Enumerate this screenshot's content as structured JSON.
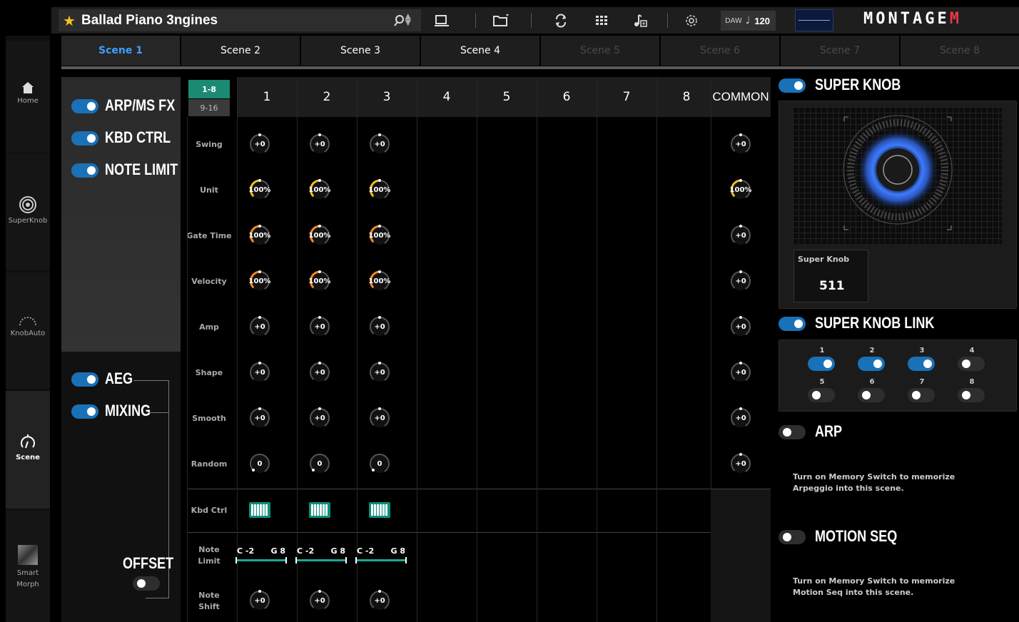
{
  "header": {
    "preset_name": "Ballad Piano 3ngines",
    "daw_label": "DAW",
    "tempo": "120",
    "logo": "MONTAGE",
    "logo_suffix": "M"
  },
  "tabs": [
    {
      "label": "Scene 1",
      "state": "active"
    },
    {
      "label": "Scene 2",
      "state": "normal"
    },
    {
      "label": "Scene 3",
      "state": "normal"
    },
    {
      "label": "Scene 4",
      "state": "normal"
    },
    {
      "label": "Scene 5",
      "state": "disabled"
    },
    {
      "label": "Scene 6",
      "state": "disabled"
    },
    {
      "label": "Scene 7",
      "state": "disabled"
    },
    {
      "label": "Scene 8",
      "state": "disabled"
    }
  ],
  "nav": [
    {
      "label": "Home",
      "icon": "home-icon"
    },
    {
      "label": "SuperKnob",
      "icon": "superknob-icon"
    },
    {
      "label": "KnobAuto",
      "icon": "knobauto-icon"
    },
    {
      "label": "Scene",
      "icon": "scene-icon"
    },
    {
      "label": "Smart\nMorph",
      "icon": "smartmorph-icon"
    }
  ],
  "switches": {
    "arp_ms_fx": "ARP/MS FX",
    "kbd_ctrl": "KBD CTRL",
    "note_limit": "NOTE LIMIT",
    "aeg": "AEG",
    "mixing": "MIXING",
    "offset": "OFFSET"
  },
  "grid": {
    "range_active": "1-8",
    "range_other": "9-16",
    "columns": [
      "1",
      "2",
      "3",
      "4",
      "5",
      "6",
      "7",
      "8"
    ],
    "common": "COMMON",
    "rows": {
      "swing": "Swing",
      "unit": "Unit",
      "gate_time": "Gate Time",
      "velocity": "Velocity",
      "amp": "Amp",
      "shape": "Shape",
      "smooth": "Smooth",
      "random": "Random",
      "kbd_ctrl": "Kbd Ctrl",
      "note_limit": "Note Limit",
      "note_shift": "Note Shift"
    },
    "values": {
      "plus0": "+0",
      "pct100": "100%",
      "zero": "0"
    },
    "note_limit_low": "C -2",
    "note_limit_high": "G 8"
  },
  "right": {
    "super_knob": "SUPER KNOB",
    "super_knob_label": "Super Knob",
    "super_knob_value": "511",
    "super_knob_link": "SUPER KNOB LINK",
    "link_parts": [
      "1",
      "2",
      "3",
      "4",
      "5",
      "6",
      "7",
      "8"
    ],
    "arp": "ARP",
    "arp_note": "Turn on Memory Switch to memorize Arpeggio into this scene.",
    "motion_seq": "MOTION SEQ",
    "motion_note": "Turn on Memory Switch to memorize Motion Seq into this scene."
  },
  "colors": {
    "accent_blue": "#1971b8",
    "tab_active": "#3ea0ff",
    "knob_orange": "#f08a24",
    "knob_yellow": "#f3c023",
    "teal": "#1ba89a"
  }
}
